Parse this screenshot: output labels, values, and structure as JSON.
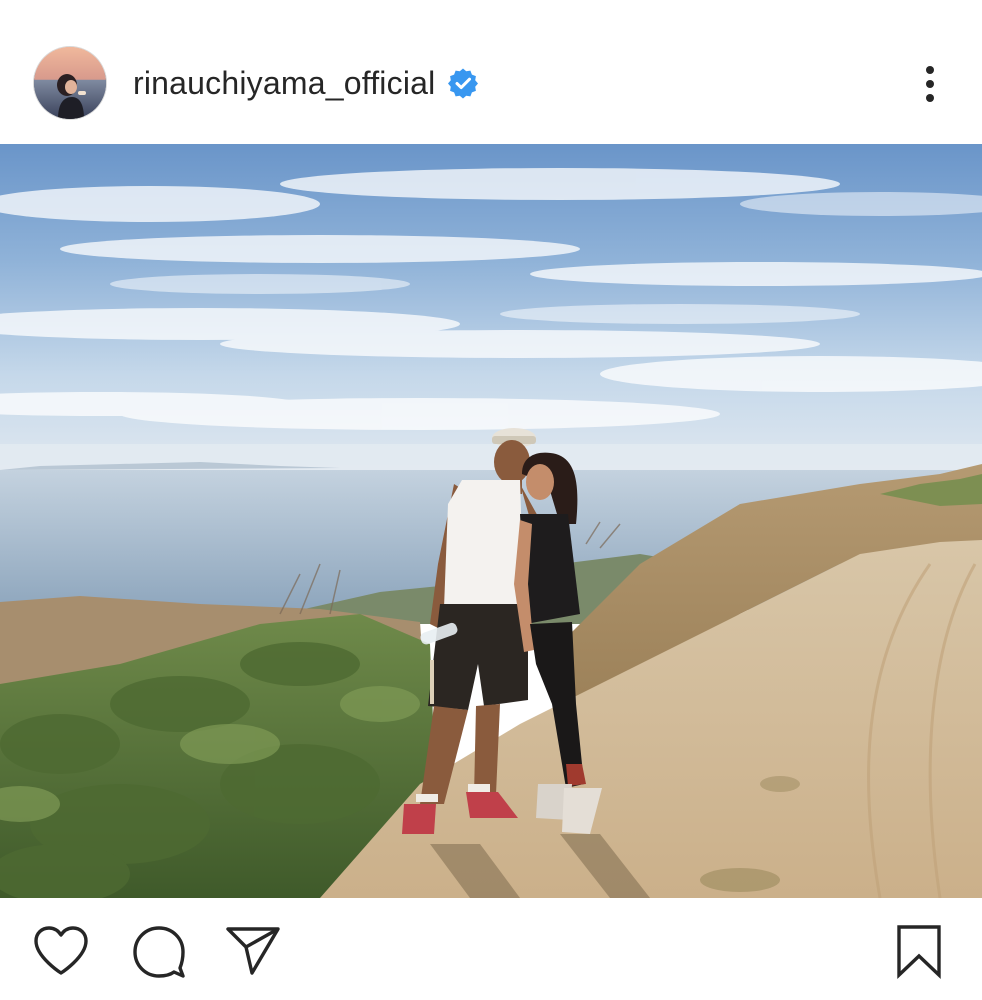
{
  "post": {
    "username": "rinauchiyama_official",
    "verified": true,
    "accent_color": "#3897f0",
    "text_color": "#262626"
  },
  "header": {
    "avatar_icon": "profile-avatar",
    "verified_icon": "verified-badge-icon",
    "more_icon": "more-options-icon"
  },
  "photo": {
    "description_icon": "post-photo"
  },
  "actions": {
    "like_icon": "heart-icon",
    "comment_icon": "comment-bubble-icon",
    "share_icon": "paper-plane-icon",
    "save_icon": "bookmark-icon"
  }
}
